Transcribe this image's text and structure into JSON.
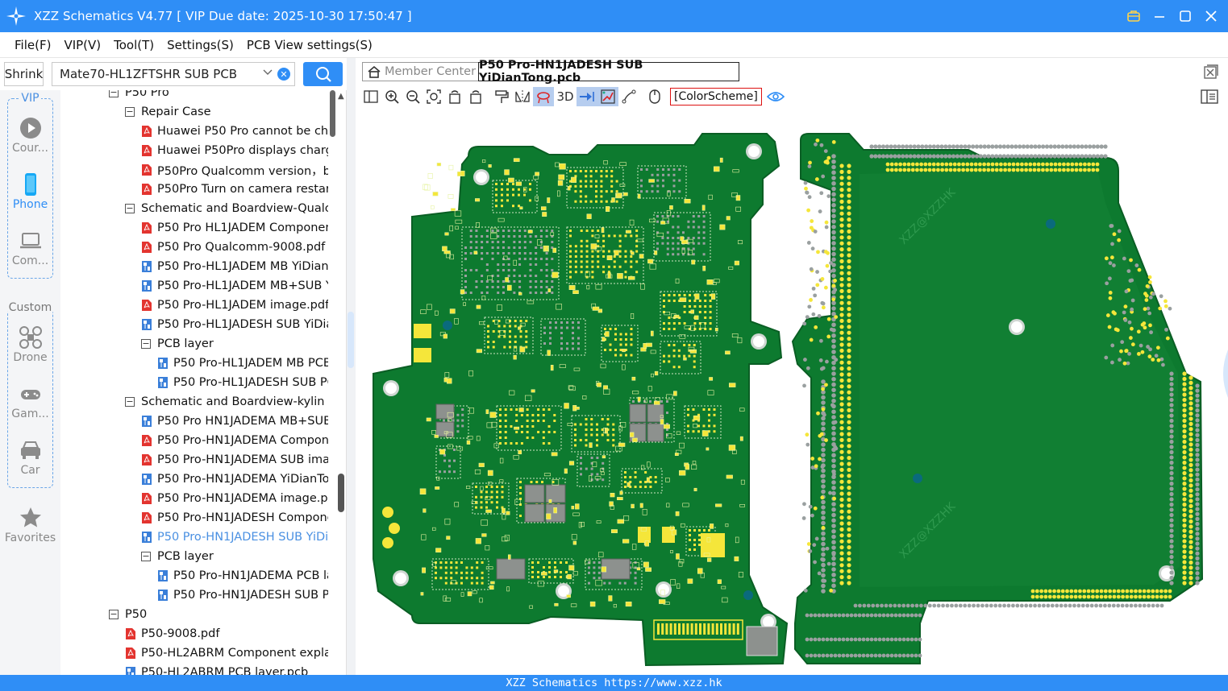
{
  "window": {
    "title": "XZZ Schematics V4.77 [ VIP Due date: 2025-10-30 17:50:47 ]",
    "controls": [
      "vip-icon",
      "minimize-icon",
      "maximize-icon",
      "close-icon"
    ]
  },
  "menubar": {
    "items": [
      "File(F)",
      "VIP(V)",
      "Tool(T)",
      "Settings(S)",
      "PCB View settings(S)"
    ]
  },
  "search": {
    "shrink_label": "Shrink",
    "value": "Mate70-HL1ZFTSHR SUB PCB"
  },
  "leftnav": {
    "vip_label": "VIP",
    "custom_label": "Custom",
    "items": [
      {
        "label": "Cour...",
        "icon": "play-icon"
      },
      {
        "label": "Phone",
        "icon": "phone-icon",
        "active": true
      },
      {
        "label": "Com...",
        "icon": "laptop-icon"
      },
      {
        "label": "Drone",
        "icon": "drone-icon"
      },
      {
        "label": "Gam...",
        "icon": "gamepad-icon"
      },
      {
        "label": "Car",
        "icon": "car-icon"
      },
      {
        "label": "Favorites",
        "icon": "star-icon"
      }
    ]
  },
  "tree": {
    "rows": [
      {
        "label": "P50 Pro",
        "type": "folder",
        "level": 0
      },
      {
        "label": "Repair Case",
        "type": "folder",
        "level": 1
      },
      {
        "label": "Huawei P50 Pro cannot be char",
        "type": "pdf",
        "level": 2
      },
      {
        "label": "Huawei P50Pro displays chargir",
        "type": "pdf",
        "level": 2
      },
      {
        "label": "P50Pro Qualcomm version，ba:",
        "type": "pdf",
        "level": 2
      },
      {
        "label": "P50Pro Turn on camera restart.p",
        "type": "pdf",
        "level": 2
      },
      {
        "label": "Schematic and Boardview-Qualcor",
        "type": "folder",
        "level": 1
      },
      {
        "label": "P50 Pro HL1JADEM Componen",
        "type": "pdf",
        "level": 2
      },
      {
        "label": "P50 Pro Qualcomm-9008.pdf",
        "type": "pdf",
        "level": 2
      },
      {
        "label": "P50 Pro-HL1JADEM MB YiDian",
        "type": "pcb",
        "level": 2
      },
      {
        "label": "P50 Pro-HL1JADEM MB+SUB Yi",
        "type": "pcb",
        "level": 2
      },
      {
        "label": "P50 Pro-HL1JADEM image.pdf",
        "type": "pdf",
        "level": 2
      },
      {
        "label": "P50 Pro-HL1JADESH SUB YiDiar",
        "type": "pcb",
        "level": 2
      },
      {
        "label": "PCB layer",
        "type": "folder",
        "level": 2
      },
      {
        "label": "P50 Pro-HL1JADEM MB PCB",
        "type": "pcb",
        "level": 3
      },
      {
        "label": "P50 Pro-HL1JADESH SUB PC",
        "type": "pcb",
        "level": 3
      },
      {
        "label": "Schematic and Boardview-kylin",
        "type": "folder",
        "level": 1
      },
      {
        "label": "P50 Pro HN1JADEMA MB+SUB",
        "type": "pcb",
        "level": 2
      },
      {
        "label": "P50 Pro-HN1JADEMA Compon",
        "type": "pdf",
        "level": 2
      },
      {
        "label": "P50 Pro-HN1JADEMA SUB imag",
        "type": "pdf",
        "level": 2
      },
      {
        "label": "P50 Pro-HN1JADEMA YiDianTo",
        "type": "pcb",
        "level": 2
      },
      {
        "label": "P50 Pro-HN1JADEMA image.pc",
        "type": "pdf",
        "level": 2
      },
      {
        "label": "P50 Pro-HN1JADESH Compone",
        "type": "pdf",
        "level": 2
      },
      {
        "label": "P50 Pro-HN1JADESH SUB YiDia",
        "type": "pcb",
        "level": 2,
        "selected": true
      },
      {
        "label": "PCB layer",
        "type": "folder",
        "level": 2
      },
      {
        "label": "P50 Pro-HN1JADEMA PCB la",
        "type": "pcb",
        "level": 3
      },
      {
        "label": "P50 Pro-HN1JADESH SUB PC",
        "type": "pcb",
        "level": 3
      },
      {
        "label": "P50",
        "type": "folder",
        "level": 0
      },
      {
        "label": "P50-9008.pdf",
        "type": "pdf",
        "level": 1
      },
      {
        "label": "P50-HL2ABRM Component explair",
        "type": "pdf",
        "level": 1
      },
      {
        "label": "P50-HL2ABRM PCB layer.pcb",
        "type": "pcb",
        "level": 1
      }
    ]
  },
  "tabs": {
    "member_center": "Member Center",
    "active": "P50 Pro-HN1JADESH SUB YiDianTong.pcb"
  },
  "toolbar": {
    "three_d_label": "3D",
    "color_scheme_label": "[ColorScheme]"
  },
  "canvas": {
    "watermarks": [
      "XZZ@XZZHK",
      "XZZ@XZZHK"
    ],
    "colors": {
      "board": "#0d7a2f",
      "pad": "#f5e63a",
      "via": "#9aa0a0",
      "hole": "#ffffff"
    }
  },
  "statusbar": {
    "text": "XZZ Schematics https://www.xzz.hk"
  }
}
